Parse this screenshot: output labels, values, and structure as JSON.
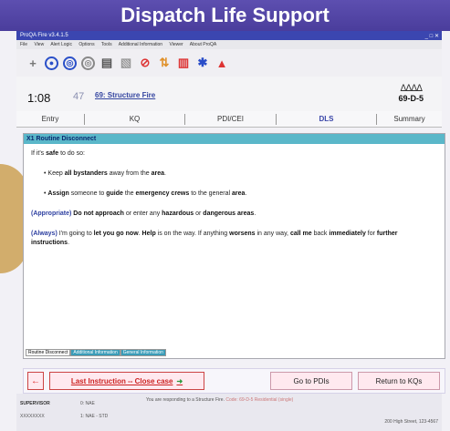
{
  "banner": {
    "title": "Dispatch Life Support"
  },
  "window": {
    "title": "ProQA Fire v3.4.1.5",
    "controls": "_ □ ✕"
  },
  "menu": [
    "File",
    "View",
    "Alert Logic",
    "Options",
    "Tools",
    "Additional Information",
    "Viewer",
    "About ProQA"
  ],
  "toolbar": {
    "icons": [
      {
        "name": "plus-icon",
        "glyph": "+"
      },
      {
        "name": "circle-blue-icon",
        "glyph": "●"
      },
      {
        "name": "circle-gray-icon",
        "glyph": "◎"
      },
      {
        "name": "circle-gray2-icon",
        "glyph": "◎"
      },
      {
        "name": "document-icon",
        "glyph": "▤"
      },
      {
        "name": "clipboard-icon",
        "glyph": "▧"
      },
      {
        "name": "stop-icon",
        "glyph": "⊘"
      },
      {
        "name": "transfer-icon",
        "glyph": "⇅"
      },
      {
        "name": "building-icon",
        "glyph": "▥"
      },
      {
        "name": "star-icon",
        "glyph": "✱"
      },
      {
        "name": "flag-icon",
        "glyph": "▲"
      }
    ]
  },
  "case": {
    "time": "1:08",
    "num": "47",
    "code_label": "69: Structure Fire",
    "determinant_symbols": "ᐃᐃᐃᐃ",
    "determinant": "69-D-5"
  },
  "tabs": [
    "Entry",
    "KQ",
    "PDI/CEI",
    "DLS",
    "Summary"
  ],
  "active_tab": "DLS",
  "panel": {
    "header": "X1 Routine Disconnect",
    "intro_a": "If it's ",
    "intro_b": "safe",
    "intro_c": " to do so:",
    "b1_a": "Keep ",
    "b1_b": "all bystanders",
    "b1_c": " away from the ",
    "b1_d": "area",
    "b1_e": ".",
    "b2_a": "Assign",
    "b2_b": " someone to ",
    "b2_c": "guide",
    "b2_d": " the ",
    "b2_e": "emergency crews",
    "b2_f": " to the general ",
    "b2_g": "area",
    "b2_h": ".",
    "p3_a": "(Appropriate)",
    "p3_b": " Do not approach",
    "p3_c": " or enter any ",
    "p3_d": "hazardous",
    "p3_e": " or ",
    "p3_f": "dangerous areas",
    "p3_g": ".",
    "p4_a": "(Always)",
    "p4_b": " I'm going to ",
    "p4_c": "let you go now",
    "p4_d": ". ",
    "p4_e": "Help",
    "p4_f": " is on the way. If anything ",
    "p4_g": "worsens",
    "p4_h": " in any way, ",
    "p4_i": "call me",
    "p4_j": " back ",
    "p4_k": "immediately",
    "p4_l": " for ",
    "p4_m": "further instructions",
    "p4_n": ".",
    "subtabs": [
      "Routine Disconnect",
      "Additional Information",
      "General Information"
    ]
  },
  "buttons": {
    "back": "←",
    "last_instruction": "Last Instruction -- Close case",
    "last_arrow": "➜",
    "go_to_pdis": "Go to PDIs",
    "return_to_kqs": "Return to KQs"
  },
  "status": {
    "role": "SUPERVISOR",
    "user_id": "XXXXXXXX",
    "c1": "0: NAE",
    "c2": "1: NAE - STD",
    "message_a": "You are responding to a Structure Fire.",
    "message_b": "Code: 69-D-5",
    "message_c": "Residential (single)",
    "address": "200 High Street, 123-4567"
  }
}
